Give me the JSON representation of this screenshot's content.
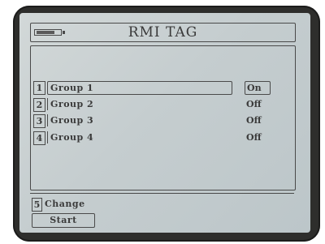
{
  "screen": {
    "title": "RMI TAG",
    "battery_icon": "battery-icon"
  },
  "groups": [
    {
      "num": "1",
      "label": "Group 1",
      "state": "On"
    },
    {
      "num": "2",
      "label": "Group 2",
      "state": "Off"
    },
    {
      "num": "3",
      "label": "Group 3",
      "state": "Off"
    },
    {
      "num": "4",
      "label": "Group 4",
      "state": "Off"
    }
  ],
  "footer": {
    "change_num": "5",
    "change_label": "Change",
    "start_label": "Start"
  },
  "colors": {
    "lcd_background": "#c5cdcf",
    "text": "#3a3a3a",
    "bezel": "#2e2e2c"
  }
}
